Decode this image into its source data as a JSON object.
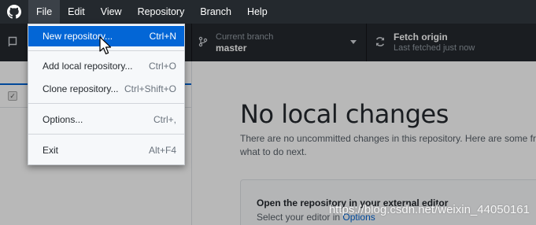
{
  "menubar": {
    "items": [
      {
        "label": "File"
      },
      {
        "label": "Edit"
      },
      {
        "label": "View"
      },
      {
        "label": "Repository"
      },
      {
        "label": "Branch"
      },
      {
        "label": "Help"
      }
    ]
  },
  "toolbar": {
    "branch": {
      "title": "Current branch",
      "value": "master"
    },
    "fetch": {
      "title": "Fetch origin",
      "value": "Last fetched just now"
    }
  },
  "file_menu": {
    "items": [
      {
        "label": "New repository...",
        "shortcut": "Ctrl+N"
      },
      {
        "label": "Add local repository...",
        "shortcut": "Ctrl+O"
      },
      {
        "label": "Clone repository...",
        "shortcut": "Ctrl+Shift+O"
      },
      {
        "label": "Options...",
        "shortcut": "Ctrl+,"
      },
      {
        "label": "Exit",
        "shortcut": "Alt+F4"
      }
    ]
  },
  "main": {
    "title": "No local changes",
    "desc_line1": "There are no uncommitted changes in this repository. Here are some frie",
    "desc_line2": "what to do next.",
    "card_title": "Open the repository in your external editor",
    "card_sub_prefix": "Select your editor in ",
    "card_sub_link": "Options"
  },
  "watermark": "https://blog.csdn.net/weixin_44050161",
  "colors": {
    "titlebar": "#24292e",
    "menu_highlight": "#0366d6",
    "link": "#0366d6"
  },
  "icons": [
    "github-logo-icon",
    "repository-icon",
    "branch-icon",
    "sync-icon",
    "mouse-cursor-icon"
  ]
}
